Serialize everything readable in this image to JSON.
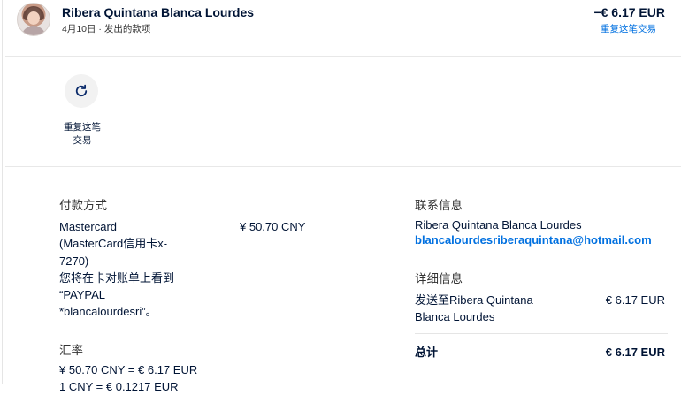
{
  "header": {
    "name": "Ribera Quintana Blanca Lourdes",
    "subline": "4月10日 · 发出的款项",
    "amount": "−€ 6.17 EUR",
    "repeat_link": "重复这笔交易"
  },
  "action": {
    "icon": "refresh-icon",
    "label_line1": "重复这笔",
    "label_line2": "交易"
  },
  "payment": {
    "heading": "付款方式",
    "method_lines": [
      "Mastercard",
      "(MasterCard信用卡x-",
      "7270)",
      "您将在卡对账单上看到",
      "“PAYPAL",
      "*blancalourdesri”。"
    ],
    "amount": "¥ 50.70 CNY"
  },
  "exchange": {
    "heading": "汇率",
    "line1": "¥ 50.70 CNY = € 6.17 EUR",
    "line2": "1 CNY = € 0.1217 EUR"
  },
  "contact": {
    "heading": "联系信息",
    "name": "Ribera Quintana Blanca Lourdes",
    "email": "blancalourdesriberaquintana@hotmail.com"
  },
  "details": {
    "heading": "详细信息",
    "sent_to_line1": "发送至Ribera Quintana",
    "sent_to_line2": "Blanca Lourdes",
    "sent_amount": "€ 6.17 EUR",
    "total_label": "总计",
    "total_amount": "€ 6.17 EUR"
  }
}
